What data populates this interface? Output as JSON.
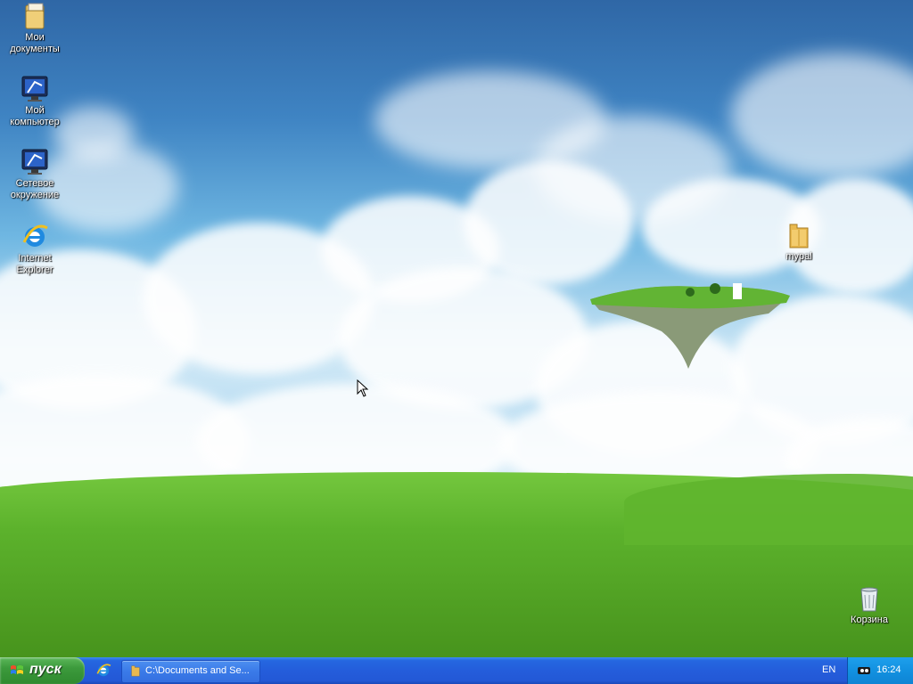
{
  "desktop": {
    "icons": [
      {
        "label": "Мои\nдокументы",
        "icon": "my-documents-folder-icon"
      },
      {
        "label": "Мой\nкомпьютер",
        "icon": "my-computer-icon"
      },
      {
        "label": "Сетевое\nокружение",
        "icon": "network-places-icon"
      },
      {
        "label": "Internet\nExplorer",
        "icon": "internet-explorer-icon"
      },
      {
        "label": "mypal",
        "icon": "folder-icon"
      },
      {
        "label": "Корзина",
        "icon": "recycle-bin-icon"
      }
    ]
  },
  "taskbar": {
    "start_label": "пуск",
    "quick_launch": [
      {
        "icon": "internet-explorer-icon"
      }
    ],
    "tasks": [
      {
        "label": "C:\\Documents and Se...",
        "icon": "folder-icon"
      }
    ],
    "language": "EN",
    "clock": "16:24",
    "tray_icons": [
      "network-icon"
    ]
  },
  "colors": {
    "taskbar_blue": "#245ddb",
    "start_green": "#3c9a3c",
    "tray_blue": "#1291e0"
  }
}
